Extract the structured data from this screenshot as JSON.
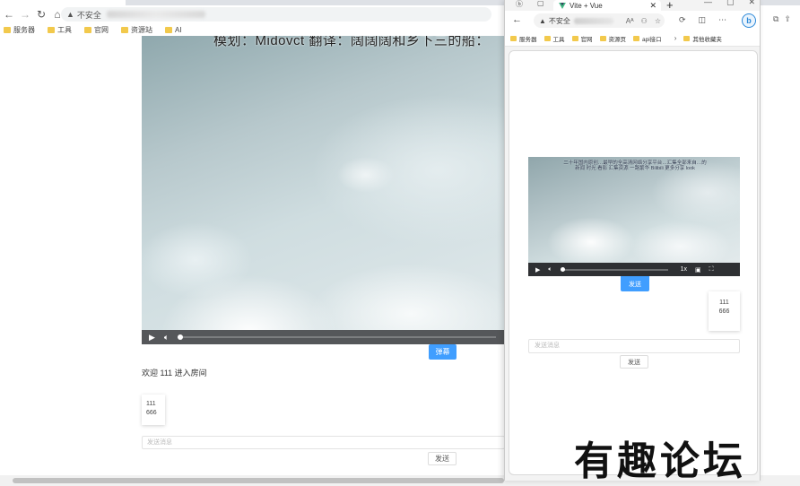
{
  "back_browser": {
    "tab_title": "",
    "url_security": "不安全",
    "bookmarks": [
      "服务器",
      "工具",
      "官网",
      "资源站",
      "AI"
    ],
    "page": {
      "subtitle": "模划：Midovct 翻译：阔阔阔和乡下三的船：",
      "danmu_button": "弹幕",
      "welcome_text": "欢迎 111 进入房间",
      "message": {
        "user": "111",
        "text": "666"
      },
      "input_placeholder": "发送消息",
      "send_button": "发送"
    }
  },
  "front_browser": {
    "tab_title": "Vite + Vue",
    "url_security": "不安全",
    "bookmarks": [
      "服务器",
      "工具",
      "官网",
      "资源页",
      "api接口"
    ],
    "bookmarks_overflow": "其他收藏夹",
    "page": {
      "subtitle_line1": "二十年国内原创…最早的全高清网络分享平台…汇集全部来自…的",
      "subtitle_line2": "新闻 时光 看影 汇集资源 一路繁华 Bilibili 更多分享 look",
      "speed": "1x",
      "danmu_button": "发送",
      "message": {
        "user": "111",
        "text": "666"
      },
      "input_placeholder": "发送消息",
      "send_button": "发送"
    }
  },
  "watermark": "有趣论坛",
  "colors": {
    "accent": "#409eff",
    "video_bar": "#2e3033",
    "folder": "#f2c94c"
  },
  "icons": [
    "back-arrow-icon",
    "forward-arrow-icon",
    "reload-icon",
    "home-icon",
    "warning-icon",
    "folder-icon",
    "play-icon",
    "volume-icon",
    "pip-icon",
    "fullscreen-icon",
    "close-icon",
    "plus-icon",
    "bing-icon"
  ]
}
